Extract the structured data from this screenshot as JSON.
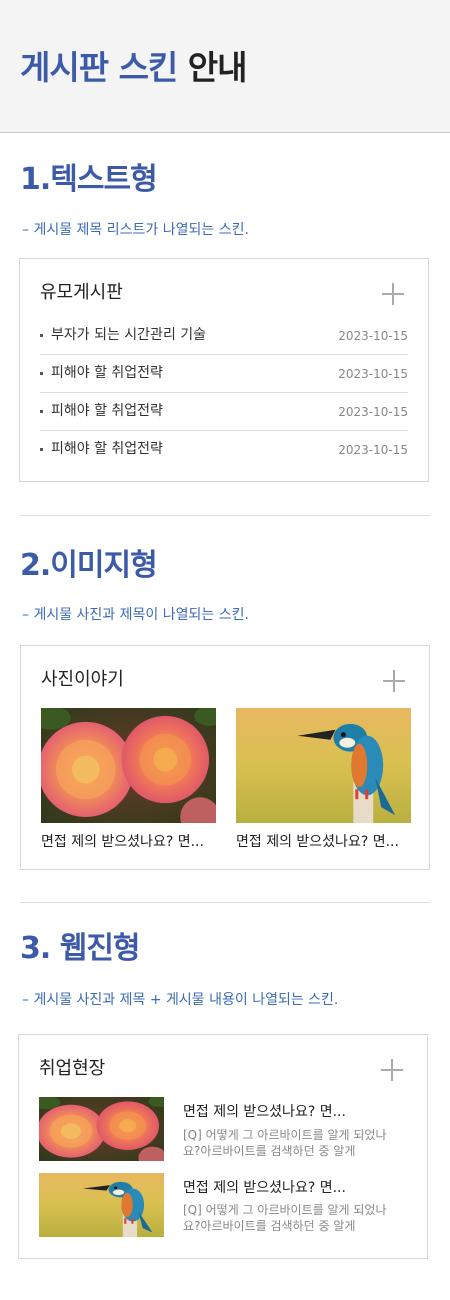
{
  "header": {
    "title_blue": "게시판 스킨",
    "title_dark": "안내"
  },
  "sections": [
    {
      "title": "1.텍스트형",
      "desc": "– 게시물 제목 리스트가 나열되는 스킨.",
      "box_title": "유모게시판",
      "items": [
        {
          "text": "부자가 되는 시간관리 기술",
          "date": "2023-10-15"
        },
        {
          "text": "피해야 할 취업전략",
          "date": "2023-10-15"
        },
        {
          "text": "피해야 할 취업전략",
          "date": "2023-10-15"
        },
        {
          "text": "피해야 할 취업전략",
          "date": "2023-10-15"
        }
      ]
    },
    {
      "title": "2.이미지형",
      "desc": "– 게시물 사진과 제목이 나열되는 스킨.",
      "box_title": "사진이야기",
      "items": [
        {
          "caption": "면접 제의 받으셨나요? 면..."
        },
        {
          "caption": "면접 제의 받으셨나요? 면..."
        }
      ]
    },
    {
      "title": "3. 웹진형",
      "desc": "– 게시물 사진과 제목 + 게시물 내용이 나열되는 스킨.",
      "box_title": "취업현장",
      "items": [
        {
          "title": "면접 제의 받으셨나요? 면...",
          "body": "[Q] 어떻게 그 아르바이트를 알게 되었나요?아르바이트를 검색하던 중 알게"
        },
        {
          "title": "면접 제의 받으셨나요? 면...",
          "body": "[Q] 어떻게 그 아르바이트를 알게 되었나요?아르바이트를 검색하던 중 알게"
        }
      ]
    }
  ],
  "icons": {
    "more": "plus-icon"
  },
  "colors": {
    "accent": "#3c5aa8",
    "desc": "#3c6ab8"
  }
}
